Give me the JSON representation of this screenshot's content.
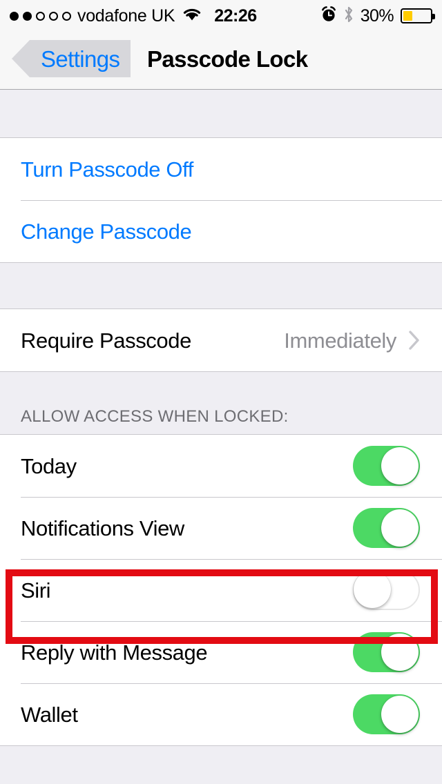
{
  "status_bar": {
    "signal_dots": {
      "total": 5,
      "filled": 2
    },
    "carrier": "vodafone UK",
    "wifi_icon": "wifi-icon",
    "time": "22:26",
    "alarm_icon": "alarm-clock-icon",
    "bluetooth_icon": "bluetooth-icon",
    "battery_percent": "30%",
    "battery_level": 30,
    "battery_fill_color": "#FFCC00"
  },
  "nav_bar": {
    "back_label": "Settings",
    "back_icon": "chevron-left-icon",
    "title": "Passcode Lock"
  },
  "groups": [
    {
      "rows": [
        {
          "label": "Turn Passcode Off",
          "style": "link"
        },
        {
          "label": "Change Passcode",
          "style": "link"
        }
      ]
    },
    {
      "rows": [
        {
          "label": "Require Passcode",
          "style": "value",
          "value": "Immediately",
          "accessory": "chevron-right-icon"
        }
      ]
    }
  ],
  "section": {
    "header": "ALLOW ACCESS WHEN LOCKED:",
    "rows": [
      {
        "label": "Today",
        "switch": "on"
      },
      {
        "label": "Notifications View",
        "switch": "on"
      },
      {
        "label": "Siri",
        "switch": "off"
      },
      {
        "label": "Reply with Message",
        "switch": "on"
      },
      {
        "label": "Wallet",
        "switch": "on"
      }
    ]
  },
  "highlight": {
    "target": "Siri",
    "color": "#E30B13"
  },
  "colors": {
    "tint": "#007AFF",
    "switch_on": "#4CD964",
    "group_background": "#EFEEF3",
    "separator": "#C8C7CC",
    "secondary_text": "#8E8E93",
    "header_text": "#6D6D72"
  }
}
